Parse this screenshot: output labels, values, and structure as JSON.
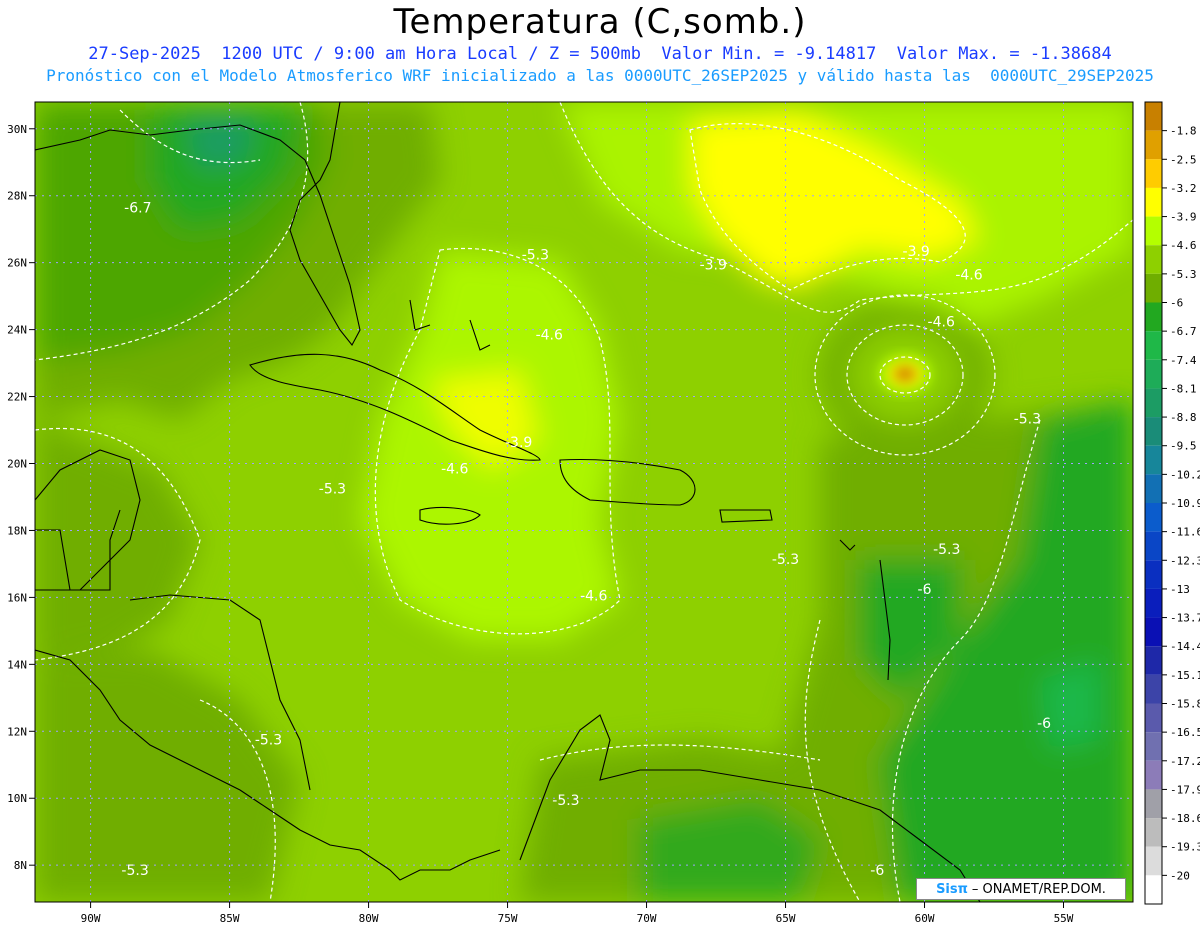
{
  "title": "Temperatura (C,somb.)",
  "subtitle1": "27-Sep-2025  1200 UTC / 9:00 am Hora Local / Z = 500mb  Valor Min. = -9.14817  Valor Max. = -1.38684",
  "subtitle2": "Pronóstico con el Modelo Atmosferico WRF inicializado a las 0000UTC_26SEP2025 y válido hasta las  0000UTC_29SEP2025",
  "credit": {
    "logo": "Sisπ",
    "org": "– ONAMET/REP.DOM."
  },
  "colors": {
    "lake": "#2a6cc8",
    "dashed_contour": "#ffffff"
  },
  "map": {
    "lon_range": [
      -92,
      -52.5
    ],
    "lat_range": [
      6.9,
      30.8
    ],
    "x_ticks": [
      "90W",
      "85W",
      "80W",
      "75W",
      "70W",
      "65W",
      "60W",
      "55W"
    ],
    "x_tick_values": [
      -90,
      -85,
      -80,
      -75,
      -70,
      -65,
      -60,
      -55
    ],
    "y_ticks": [
      "30N",
      "28N",
      "26N",
      "24N",
      "22N",
      "20N",
      "18N",
      "16N",
      "14N",
      "12N",
      "10N",
      "8N"
    ],
    "y_tick_values": [
      30,
      28,
      26,
      24,
      22,
      20,
      18,
      16,
      14,
      12,
      10,
      8
    ],
    "contour_labels": [
      {
        "text": "-6.7",
        "lon": -88.3,
        "lat": 27.5
      },
      {
        "text": "-5.3",
        "lon": -74.0,
        "lat": 26.1
      },
      {
        "text": "-3.9",
        "lon": -67.6,
        "lat": 25.8
      },
      {
        "text": "-3.9",
        "lon": -60.3,
        "lat": 26.2
      },
      {
        "text": "-4.6",
        "lon": -58.4,
        "lat": 25.5
      },
      {
        "text": "-4.6",
        "lon": -73.5,
        "lat": 23.7
      },
      {
        "text": "-4.6",
        "lon": -59.4,
        "lat": 24.1
      },
      {
        "text": "-5.3",
        "lon": -56.3,
        "lat": 21.2
      },
      {
        "text": "-3.9",
        "lon": -74.6,
        "lat": 20.5
      },
      {
        "text": "-4.6",
        "lon": -76.9,
        "lat": 19.7
      },
      {
        "text": "-5.3",
        "lon": -81.3,
        "lat": 19.1
      },
      {
        "text": "-5.3",
        "lon": -65.0,
        "lat": 17.0
      },
      {
        "text": "-5.3",
        "lon": -59.2,
        "lat": 17.3
      },
      {
        "text": "-4.6",
        "lon": -71.9,
        "lat": 15.9
      },
      {
        "text": "-6",
        "lon": -60.0,
        "lat": 16.1
      },
      {
        "text": "-6",
        "lon": -55.7,
        "lat": 12.1
      },
      {
        "text": "-5.3",
        "lon": -83.6,
        "lat": 11.6
      },
      {
        "text": "-5.3",
        "lon": -72.9,
        "lat": 9.8
      },
      {
        "text": "-5.3",
        "lon": -88.4,
        "lat": 7.7
      },
      {
        "text": "-6",
        "lon": -61.7,
        "lat": 7.7
      }
    ]
  },
  "colorbar": {
    "labels": [
      "-1.8",
      "-2.5",
      "-3.2",
      "-3.9",
      "-4.6",
      "-5.3",
      "-6",
      "-6.7",
      "-7.4",
      "-8.1",
      "-8.8",
      "-9.5",
      "-10.2",
      "-10.9",
      "-11.6",
      "-12.3",
      "-13",
      "-13.7",
      "-14.4",
      "-15.1",
      "-15.8",
      "-16.5",
      "-17.2",
      "-17.9",
      "-18.6",
      "-19.3",
      "-20"
    ],
    "colors": [
      "#c88000",
      "#e0a000",
      "#ffcc00",
      "#ffff00",
      "#b4ff00",
      "#8ed000",
      "#6fae00",
      "#22a820",
      "#1fb848",
      "#1eac58",
      "#1c9c64",
      "#1a8c78",
      "#17869a",
      "#1270b4",
      "#0b5ccc",
      "#0a46c6",
      "#0a2fc0",
      "#0a1ebc",
      "#0a10b4",
      "#1e28a8",
      "#3c44a8",
      "#5a5aac",
      "#7070b0",
      "#8c7cb8",
      "#a0a0a8",
      "#bcbcbc",
      "#dcdcdc",
      "#ffffff"
    ]
  }
}
